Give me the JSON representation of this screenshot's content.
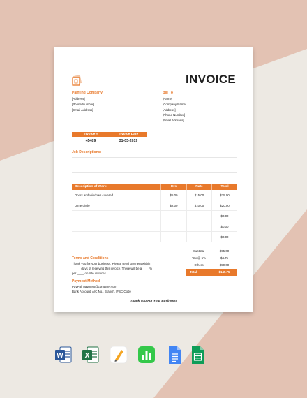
{
  "document": {
    "title": "INVOICE",
    "company": {
      "name": "Painting Company",
      "lines": [
        "[Address]",
        "[Phone Number]",
        "[Email Address]"
      ]
    },
    "bill_to": {
      "heading": "Bill To",
      "lines": [
        "[Name]",
        "[Company Name]",
        "[Address]",
        "[Phone Number]",
        "[Email Address]"
      ]
    },
    "meta": {
      "invoice_no_label": "Invoice #",
      "invoice_date_label": "Invoice Date",
      "invoice_no": "45489",
      "invoice_date": "31-03-2019"
    },
    "job_descriptions_label": "Job Descriptions:",
    "table": {
      "headers": {
        "desc": "Description of Work",
        "hrs": "Hrs",
        "rate": "Rate",
        "total": "Total"
      },
      "rows": [
        {
          "desc": "Doors and windows covered",
          "hrs": "$5.00",
          "rate": "$15.00",
          "total": "$75.00"
        },
        {
          "desc": "Dime circle",
          "hrs": "$2.00",
          "rate": "$10.00",
          "total": "$20.00"
        },
        {
          "desc": "",
          "hrs": "",
          "rate": "",
          "total": "$0.00"
        },
        {
          "desc": "",
          "hrs": "",
          "rate": "",
          "total": "$0.00"
        },
        {
          "desc": "",
          "hrs": "",
          "rate": "",
          "total": "$0.00"
        }
      ]
    },
    "totals": {
      "subtotal_label": "Subtotal",
      "subtotal": "$95.00",
      "tax_label": "Tax @ 5%",
      "tax": "$4.75",
      "others_label": "Others",
      "others": "$50.00",
      "total_label": "Total",
      "total": "$149.75"
    },
    "terms": {
      "title": "Terms and Conditions",
      "lines": [
        "Thank you for your business. Please send payment within",
        "_____ days of receiving this invoice. There will be a ____%",
        "per ____ on late invoices."
      ]
    },
    "payment": {
      "title": "Payment Method",
      "lines": [
        "PayPal: payment@company.com",
        "Bank Account: A/C No., Branch, IFSC Code"
      ]
    },
    "thanks": "Thank You For Your Business!"
  },
  "apps": [
    "word-icon",
    "excel-icon",
    "pages-icon",
    "numbers-icon",
    "google-docs-icon",
    "google-sheets-icon"
  ],
  "colors": {
    "accent": "#e8792b",
    "peach": "#e3c2b3",
    "background": "#ede9e3"
  }
}
